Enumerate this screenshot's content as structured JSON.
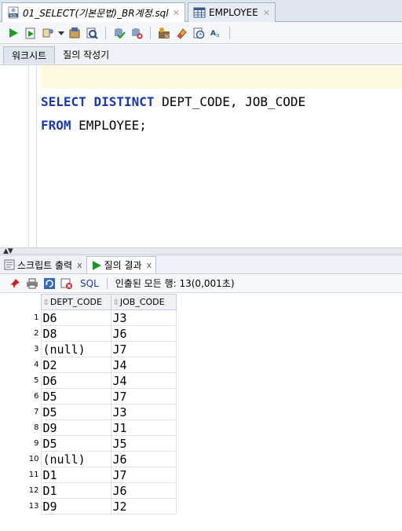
{
  "tabs": [
    {
      "label": "01_SELECT(기본문법)_BR계정.sql",
      "icon": "sql-file-icon",
      "active": true
    },
    {
      "label": "EMPLOYEE",
      "icon": "table-icon",
      "active": false
    }
  ],
  "subtabs": [
    "워크시트",
    "질의 작성기"
  ],
  "editor": {
    "line1": {
      "kw1": "SELECT",
      "kw2": "DISTINCT",
      "rest": " DEPT_CODE, JOB_CODE"
    },
    "line2": {
      "kw1": "FROM",
      "rest": " EMPLOYEE;"
    }
  },
  "result_tabs": [
    {
      "label": "스크립트 출력",
      "icon": "script-output-icon"
    },
    {
      "label": "질의 결과",
      "icon": "run-icon"
    }
  ],
  "result_toolbar": {
    "sql_label": "SQL",
    "status": "인출된 모든 행: 13(0,001초)"
  },
  "grid": {
    "columns": [
      "DEPT_CODE",
      "JOB_CODE"
    ],
    "rows": [
      [
        "D6",
        "J3"
      ],
      [
        "D8",
        "J6"
      ],
      [
        "(null)",
        "J7"
      ],
      [
        "D2",
        "J4"
      ],
      [
        "D6",
        "J4"
      ],
      [
        "D5",
        "J7"
      ],
      [
        "D5",
        "J3"
      ],
      [
        "D9",
        "J1"
      ],
      [
        "D5",
        "J5"
      ],
      [
        "(null)",
        "J6"
      ],
      [
        "D1",
        "J7"
      ],
      [
        "D1",
        "J6"
      ],
      [
        "D9",
        "J2"
      ]
    ]
  },
  "colors": {
    "keyword": "#1a3aa8",
    "current_line": "#fefbe0",
    "run_green": "#1e9a2a"
  }
}
